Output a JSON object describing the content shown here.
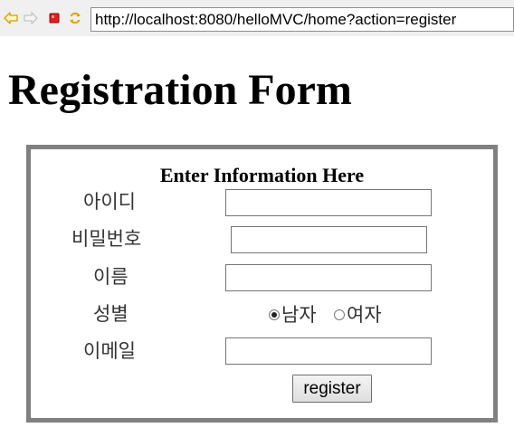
{
  "browser": {
    "url": "http://localhost:8080/helloMVC/home?action=register",
    "icons": [
      "back-arrow-icon",
      "forward-arrow-icon",
      "stop-icon",
      "refresh-icon"
    ],
    "accent_colors": {
      "back": "#e8b000",
      "stop": "#e02020",
      "refresh": "#e8a000"
    }
  },
  "page": {
    "title": "Registration Form"
  },
  "form": {
    "caption": "Enter Information Here",
    "fields": {
      "id_label": "아이디",
      "id_value": "",
      "password_label": "비밀번호",
      "password_value": "",
      "name_label": "이름",
      "name_value": "",
      "gender_label": "성별",
      "gender_options": [
        "남자",
        "여자"
      ],
      "gender_selected": "남자",
      "email_label": "이메일",
      "email_value": ""
    },
    "submit_label": "register"
  }
}
